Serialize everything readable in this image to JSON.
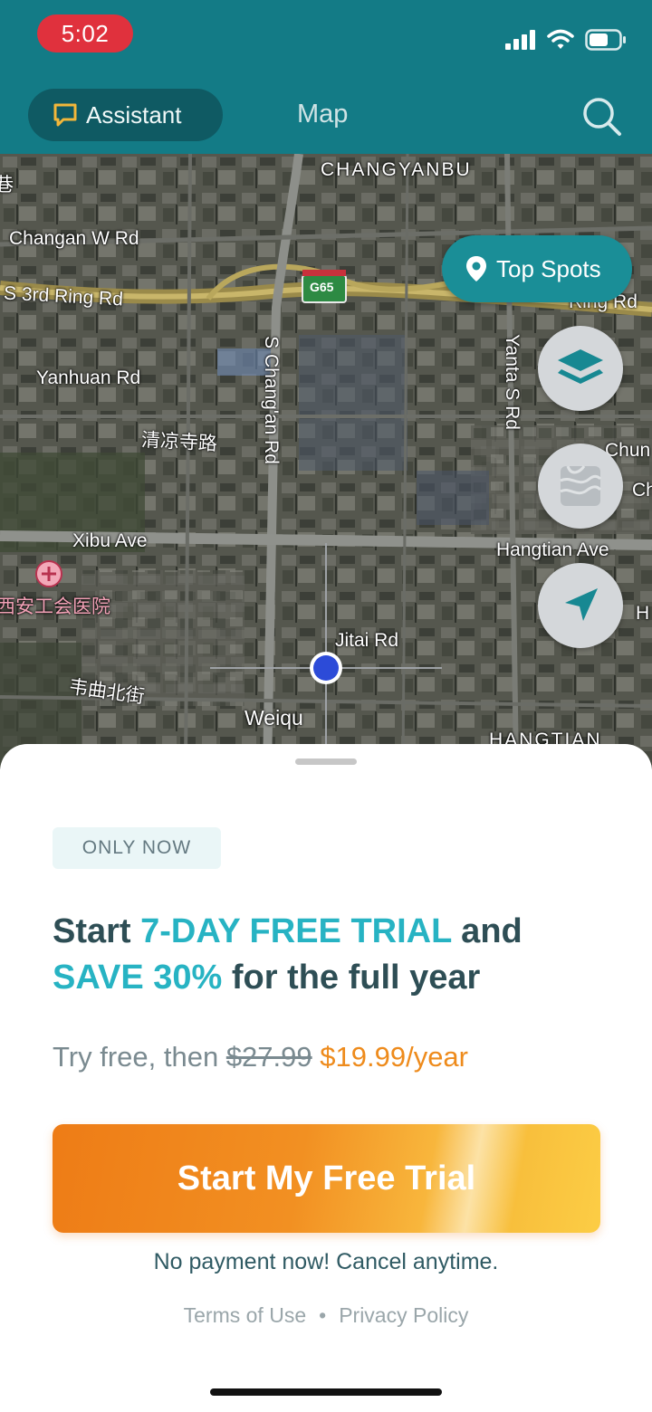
{
  "status_bar": {
    "time": "5:02",
    "time_badge_color": "#e0313d"
  },
  "header": {
    "background": "#137b86",
    "assistant_tab": {
      "label": "Assistant",
      "icon": "chat-bubble-icon"
    },
    "map_tab": {
      "label": "Map"
    },
    "search": {
      "icon": "search-icon"
    }
  },
  "map": {
    "labels": {
      "changyanbu": "CHANGYANBU",
      "changan_w_rd": "Changan W Rd",
      "s_3rd_ring_rd": "S 3rd Ring Rd",
      "ring_rd_right": "Ring Rd",
      "g65": "G65",
      "s_changan_rd": "S Chang'an Rd",
      "yanta_s_rd": "Yanta S Rd",
      "yanhuan_rd": "Yanhuan Rd",
      "qingliangsi": "清凉寺路",
      "xibu_ave": "Xibu Ave",
      "hospital": "西安工会医院",
      "hangtian_ave": "Hangtian Ave",
      "jitai_rd": "Jitai Rd",
      "weiqu_st": "韦曲北街",
      "weiqu": "Weiqu",
      "hangtian_bottom": "HANGTIAN",
      "chun": "Chun",
      "ch": "Ch",
      "h_edge": "H",
      "left_edge": "巷"
    },
    "top_spots": {
      "label": "Top Spots",
      "icon": "location-pin-icon"
    },
    "buttons": [
      "layers-icon",
      "terrain-icon",
      "navigate-arrow-icon"
    ]
  },
  "sheet": {
    "badge": "ONLY NOW",
    "headline": {
      "start": "Start ",
      "trial": "7-DAY FREE TRIAL",
      "and": " and",
      "save": "SAVE 30%",
      "rest": " for the full year"
    },
    "price": {
      "prefix": "Try free, then ",
      "old_price": "$27.99",
      "new_price": "$19.99/year"
    },
    "cta_label": "Start My Free Trial",
    "note": "No payment now! Cancel anytime.",
    "terms": "Terms of Use",
    "separator": "•",
    "privacy": "Privacy Policy",
    "accent_color": "#27b3c3",
    "price_color": "#ee8b1c"
  }
}
